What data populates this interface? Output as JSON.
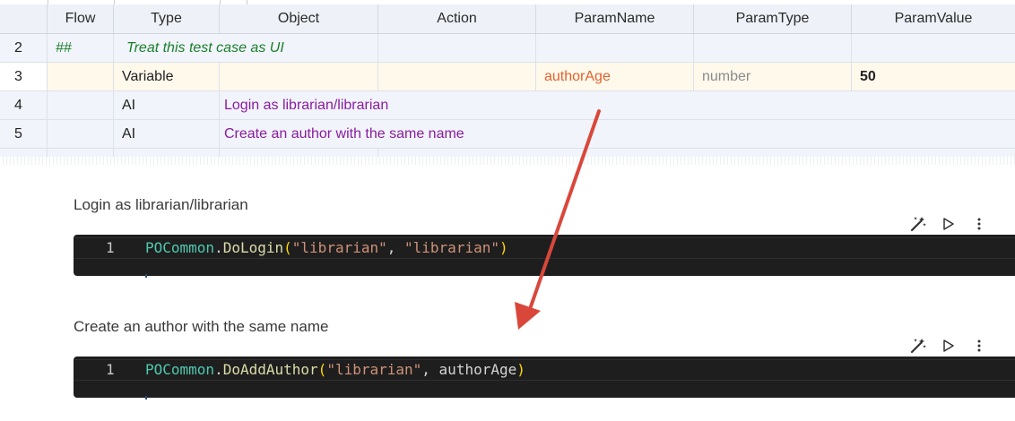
{
  "grid": {
    "columns": [
      "Flow",
      "Type",
      "Object",
      "Action",
      "ParamName",
      "ParamType",
      "ParamValue"
    ],
    "rows": [
      {
        "num": "2",
        "flow": "##",
        "type": "Treat this test case as UI",
        "object": "",
        "action": "",
        "param_name": "",
        "param_type": "",
        "param_value": ""
      },
      {
        "num": "3",
        "flow": "",
        "type": "Variable",
        "object": "",
        "action": "",
        "param_name": "authorAge",
        "param_type": "number",
        "param_value": "50"
      },
      {
        "num": "4",
        "flow": "",
        "type": "AI",
        "object": "Login as librarian/librarian",
        "action": "",
        "param_name": "",
        "param_type": "",
        "param_value": ""
      },
      {
        "num": "5",
        "flow": "",
        "type": "AI",
        "object": "Create an author with the same name",
        "action": "",
        "param_name": "",
        "param_type": "",
        "param_value": ""
      }
    ],
    "colors": {
      "comment": "#1a7f2b",
      "ai_object": "#8a1c9e",
      "param_name": "#e0622c",
      "param_type": "#8a8a8a"
    }
  },
  "blocks": [
    {
      "label": "Login as librarian/librarian",
      "line_number": "1",
      "code": {
        "cls": "POCommon",
        "dot": ".",
        "fn": "DoLogin",
        "open": "(",
        "arg1": "\"librarian\"",
        "sep": ", ",
        "arg2": "\"librarian\"",
        "close": ")"
      },
      "tools": [
        "magic-wand-icon",
        "play-icon",
        "more-icon"
      ]
    },
    {
      "label": "Create an author with the same name",
      "line_number": "1",
      "code": {
        "cls": "POCommon",
        "dot": ".",
        "fn": "DoAddAuthor",
        "open": "(",
        "arg1": "\"librarian\"",
        "sep": ", ",
        "arg2": "authorAge",
        "close": ")"
      },
      "tools": [
        "magic-wand-icon",
        "play-icon",
        "more-icon"
      ]
    }
  ],
  "annotation": {
    "arrow_color": "#d9473b"
  }
}
